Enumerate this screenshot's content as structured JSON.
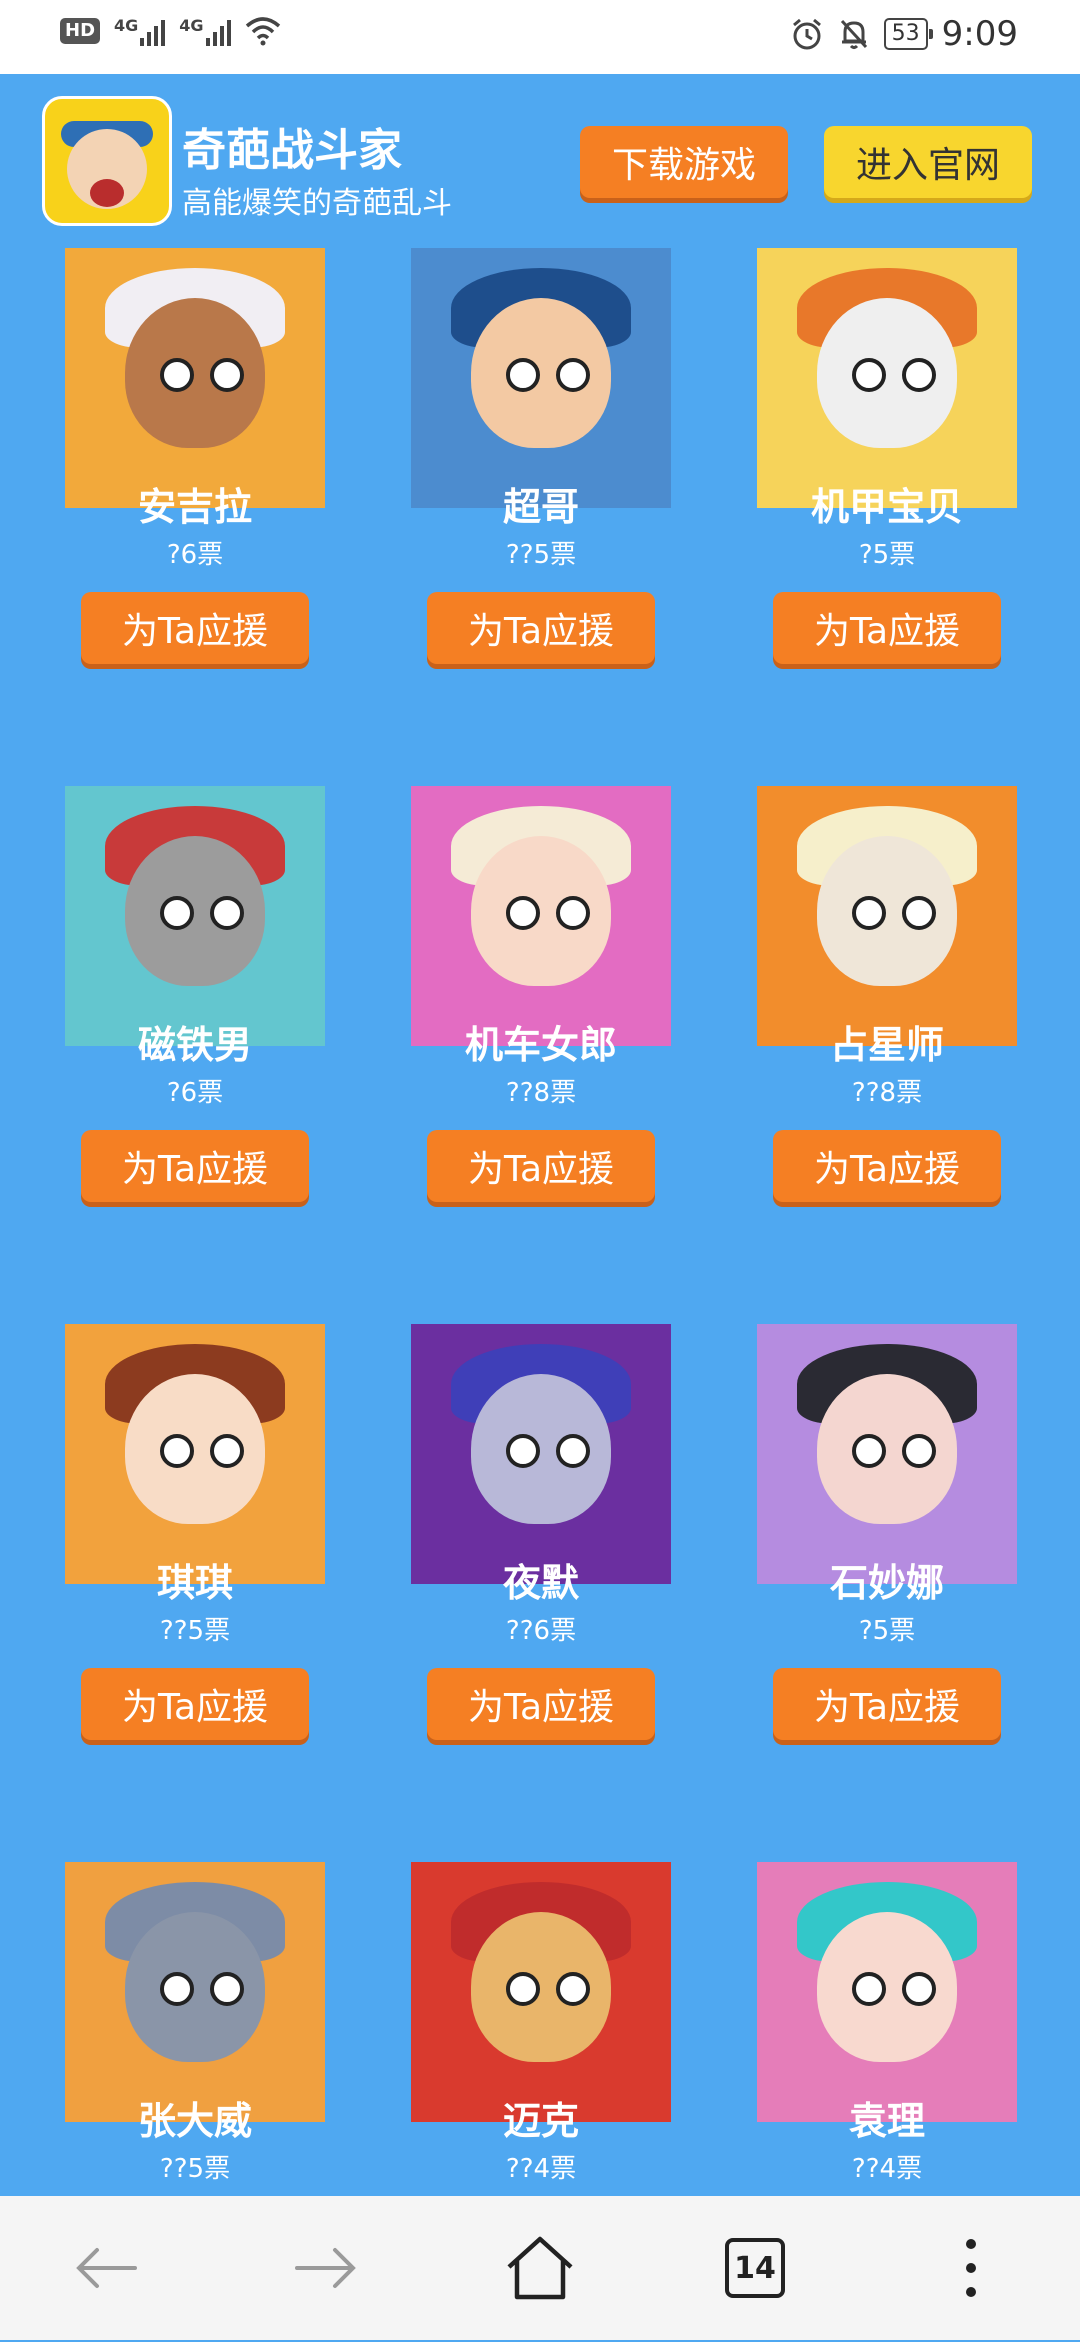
{
  "status": {
    "hd": "HD",
    "net1": "4G",
    "net2": "4G",
    "battery": "53",
    "time": "9:09"
  },
  "app": {
    "title": "奇葩战斗家",
    "subtitle": "高能爆笑的奇葩乱斗",
    "download_label": "下载游戏",
    "official_label": "进入官网"
  },
  "cheer_label": "为Ta应援",
  "characters": [
    {
      "name": "安吉拉",
      "votes": "?6票",
      "bg": "#F2A93B",
      "hair": "#F1EEF3",
      "skin": "#B9784A"
    },
    {
      "name": "超哥",
      "votes": "??5票",
      "bg": "#4C8CCF",
      "hair": "#1E4E8C",
      "skin": "#F3C9A3"
    },
    {
      "name": "机甲宝贝",
      "votes": "?5票",
      "bg": "#F6D35A",
      "hair": "#E8782A",
      "skin": "#EFEFEF"
    },
    {
      "name": "磁铁男",
      "votes": "?6票",
      "bg": "#63C6CF",
      "hair": "#C83A3A",
      "skin": "#9C9C9C"
    },
    {
      "name": "机车女郎",
      "votes": "??8票",
      "bg": "#E36CC2",
      "hair": "#F5EBD6",
      "skin": "#F8D9C8"
    },
    {
      "name": "占星师",
      "votes": "??8票",
      "bg": "#F28D2C",
      "hair": "#F6EFCB",
      "skin": "#EFE6D8"
    },
    {
      "name": "琪琪",
      "votes": "??5票",
      "bg": "#F2A23D",
      "hair": "#8C3B1F",
      "skin": "#F8DCC6"
    },
    {
      "name": "夜默",
      "votes": "??6票",
      "bg": "#6B2FA0",
      "hair": "#3F3FB8",
      "skin": "#B8B8D8"
    },
    {
      "name": "石妙娜",
      "votes": "?5票",
      "bg": "#B58CE0",
      "hair": "#2A2A33",
      "skin": "#F4D6D0"
    },
    {
      "name": "张大威",
      "votes": "??5票",
      "bg": "#F0A040",
      "hair": "#7D8CA6",
      "skin": "#8A95A8"
    },
    {
      "name": "迈克",
      "votes": "??4票",
      "bg": "#D93A2E",
      "hair": "#C02C2C",
      "skin": "#E9B56A"
    },
    {
      "name": "袁理",
      "votes": "??4票",
      "bg": "#E57DB9",
      "hair": "#33C7C9",
      "skin": "#F8D9CF"
    }
  ],
  "nav": {
    "back_icon": "arrow-left-icon",
    "forward_icon": "arrow-right-icon",
    "home_icon": "home-icon",
    "tab_count": "14",
    "menu_icon": "more-vertical-icon"
  }
}
